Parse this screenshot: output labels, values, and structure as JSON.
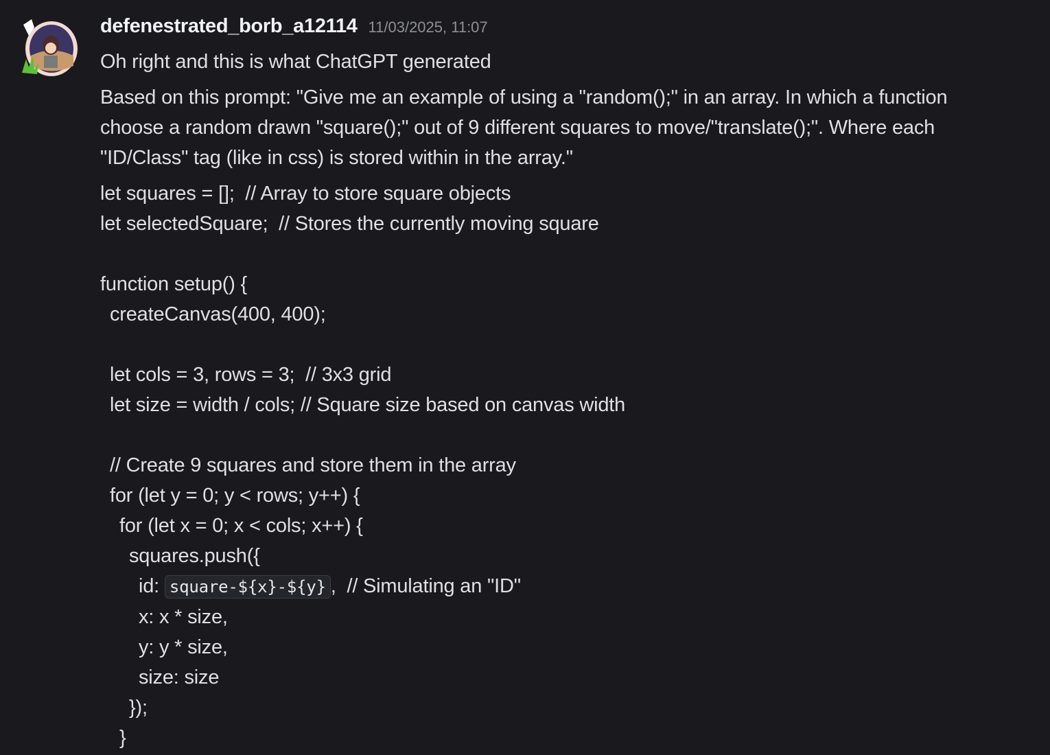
{
  "message": {
    "username": "defenestrated_borb_a12114",
    "timestamp": "11/03/2025, 11:07",
    "first_line": "Oh right and this is what ChatGPT generated",
    "paragraph": "Based on this prompt: \"Give me an example of using a \"random();\" in an array. In which a function choose a random drawn \"square();\" out of 9 different squares to move/\"translate();\". Where each \"ID/Class\" tag (like in css) is stored within in the array.\"",
    "code_lines": [
      "let squares = [];  // Array to store square objects",
      "let selectedSquare;  // Stores the currently moving square",
      "",
      "function setup() {",
      " createCanvas(400, 400);",
      "",
      " let cols = 3, rows = 3;  // 3x3 grid",
      " let size = width / cols; // Square size based on canvas width",
      "",
      " // Create 9 squares and store them in the array",
      " for (let y = 0; y < rows; y++) {",
      "  for (let x = 0; x < cols; x++) {",
      "   squares.push({",
      "    id: ",
      "    x: x * size,",
      "    y: y * size,",
      "    size: size",
      "   });",
      "  }"
    ],
    "inline_code": "square-${x}-${y}",
    "inline_code_suffix": ",  // Simulating an \"ID\""
  }
}
